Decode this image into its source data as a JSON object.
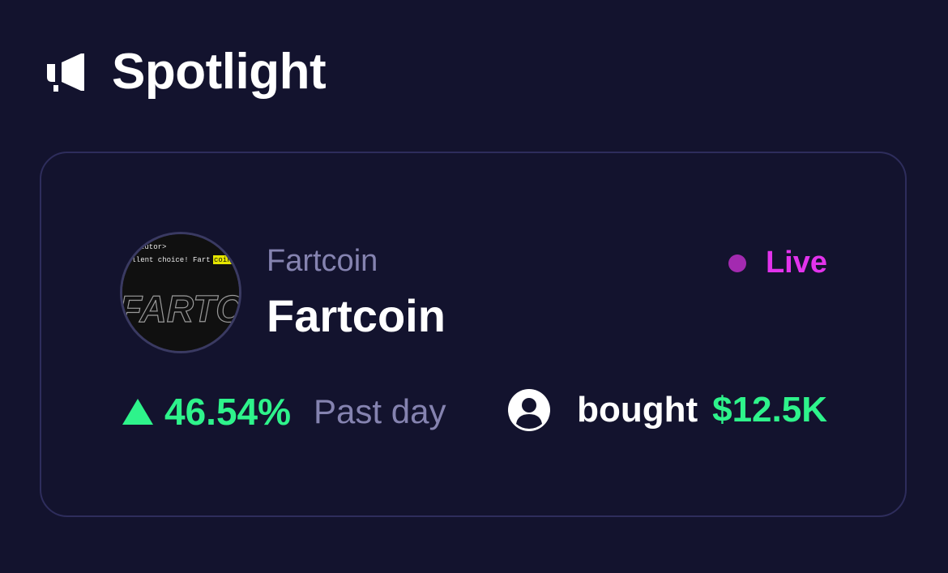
{
  "section": {
    "title": "Spotlight",
    "icon": "megaphone-icon"
  },
  "card": {
    "coin_subtitle": "Fartcoin",
    "coin_name": "Fartcoin",
    "status": "Live",
    "change": {
      "value": "46.54%",
      "direction": "up",
      "period": "Past day"
    },
    "bought": {
      "label": "bought",
      "amount": "$12.5K",
      "icon": "user-icon"
    },
    "avatar_text": {
      "line1": "tutor>",
      "line2": "ellent choice! Fart",
      "line2_highlight": "coin",
      "logo": "FARTC"
    }
  },
  "colors": {
    "background": "#13132e",
    "card_border": "#2e2d5c",
    "muted": "#8583b0",
    "positive": "#2ef38b",
    "live_dot": "#a32ab0",
    "live_text": "#e233ec"
  }
}
